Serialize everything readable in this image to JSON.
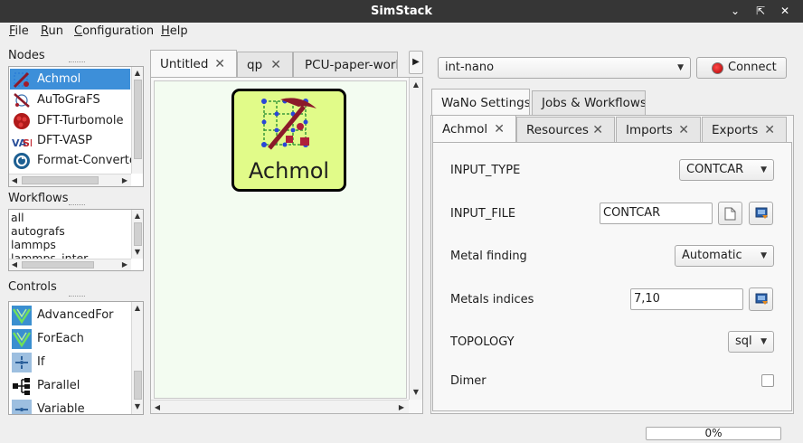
{
  "window": {
    "title": "SimStack"
  },
  "menu": [
    "File",
    "Run",
    "Configuration",
    "Help"
  ],
  "nodes": {
    "label": "Nodes",
    "items": [
      "Achmol",
      "AuToGraFS",
      "DFT-Turbomole",
      "DFT-VASP",
      "Format-Converter"
    ],
    "selected": "Achmol"
  },
  "workflows": {
    "label": "Workflows",
    "items": [
      "all",
      "autografs",
      "lammps",
      "lammps_inter"
    ]
  },
  "controls": {
    "label": "Controls",
    "items": [
      "AdvancedFor",
      "ForEach",
      "If",
      "Parallel",
      "Variable"
    ]
  },
  "editor_tabs": [
    "Untitled",
    "qp",
    "PCU-paper-workf"
  ],
  "canvas": {
    "node_label": "Achmol"
  },
  "server": {
    "selected": "int-nano",
    "connect_label": "Connect"
  },
  "top_tabs": [
    "WaNo Settings",
    "Jobs & Workflows"
  ],
  "sub_tabs": [
    "Achmol",
    "Resources",
    "Imports",
    "Exports"
  ],
  "form": {
    "input_type": {
      "label": "INPUT_TYPE",
      "value": "CONTCAR"
    },
    "input_file": {
      "label": "INPUT_FILE",
      "value": "CONTCAR"
    },
    "metal_finding": {
      "label": "Metal finding",
      "value": "Automatic"
    },
    "metals_indices": {
      "label": "Metals indices",
      "value": "7,10"
    },
    "topology": {
      "label": "TOPOLOGY",
      "value": "sql"
    },
    "dimer": {
      "label": "Dimer",
      "checked": false
    }
  },
  "status": {
    "progress_text": "0%",
    "progress": 0
  },
  "colors": {
    "selection": "#3d8fd9",
    "canvas_bg": "#f3fcf1",
    "node_fill": "#e1fb89"
  }
}
